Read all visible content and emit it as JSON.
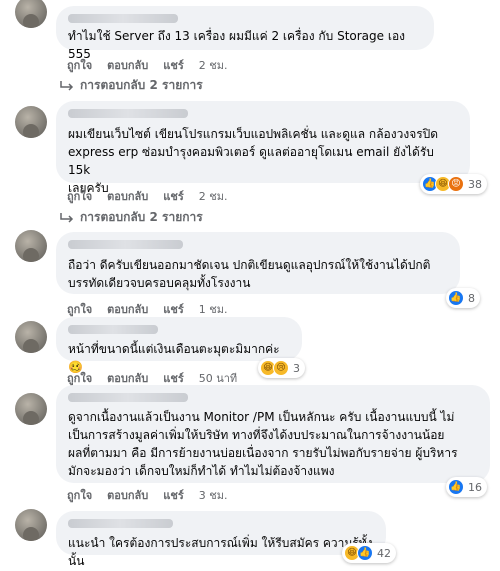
{
  "comments": [
    {
      "text": "ทำไมใช้ Server ถึง 13 เครื่อง ผมมีแค่ 2 เครื่อง กับ Storage เอง 555",
      "actions": [
        "ถูกใจ",
        "ตอบกลับ",
        "แชร์",
        "2 ชม."
      ],
      "replies": "การตอบกลับ 2 รายการ"
    },
    {
      "text": "ผมเขียนเว็บไซต์ เขียนโปรแกรมเว็บแอปพลิเคชั่น และดูแล กล้องวงจรปิด\nexpress erp ซ่อมบำรุงคอมพิวเตอร์ ดูแลต่ออายุโดเมน email ยังได้รับ 15k\nเลยครับ",
      "actions": [
        "ถูกใจ",
        "ตอบกลับ",
        "แชร์",
        "2 ชม."
      ],
      "reactions": {
        "icons": [
          "like-icon",
          "haha-icon",
          "angry-icon"
        ],
        "count": "38"
      },
      "replies": "การตอบกลับ 2 รายการ"
    },
    {
      "text": "ถือว่า ดีครับเขียนออกมาชัดเจน ปกติเขียนดูแลอุปกรณ์ให้ใช้งานได้ปกติ\nบรรทัดเดียวจบครอบคลุมทั้งโรงงาน",
      "actions": [
        "ถูกใจ",
        "ตอบกลับ",
        "แชร์",
        "1 ชม."
      ],
      "reactions": {
        "icons": [
          "like-icon"
        ],
        "count": "8"
      }
    },
    {
      "text": "หน้าที่ขนาดนี้แต่เงินเดือนตะมุตะมิมากค่ะ 🥴",
      "actions": [
        "ถูกใจ",
        "ตอบกลับ",
        "แชร์",
        "50 นาที"
      ],
      "reactions": {
        "icons": [
          "haha-icon",
          "sad-icon"
        ],
        "count": "3"
      }
    },
    {
      "text": "ดูจากเนื้องานแล้วเป็นงาน Monitor /PM เป็นหลักนะ ครับ เนื้องานแบบนี้ ไม่\nเป็นการสร้างมูลค่าเพิ่มให้บริษัท ทางที่จึงได้งบประมาณในการจ้างงานน้อย\nผลที่ตามมา คือ มีการย้ายงานบ่อยเนื่องจาก รายรับไม่พอกับรายจ่าย ผู้บริหาร\nมักจะมองว่า เด็กจบใหม่ก็ทำได้ ทำไมไม่ต้องจ้างแพง",
      "actions": [
        "ถูกใจ",
        "ตอบกลับ",
        "แชร์",
        "3 ชม."
      ],
      "reactions": {
        "icons": [
          "like-icon"
        ],
        "count": "16"
      }
    },
    {
      "text": "แนะนำ ใครต้องการประสบการณ์เพิ่ม ให้รีบสมัคร ความรู้ทั้งนั้น",
      "reactions": {
        "icons": [
          "haha-icon",
          "like-icon"
        ],
        "count": "42"
      }
    }
  ]
}
